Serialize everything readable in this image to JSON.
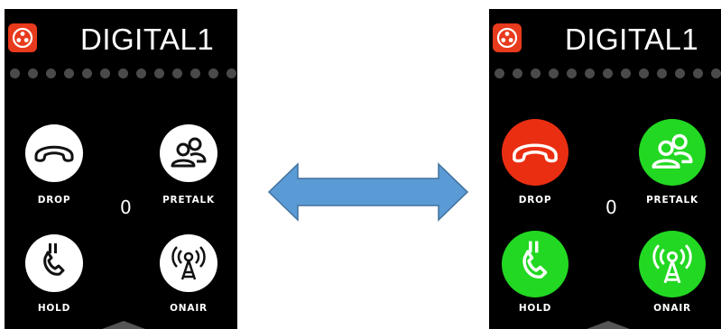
{
  "colors": {
    "screen_bg": "#000000",
    "app_icon_red": "#e83a1c",
    "dot_inactive": "#4a4a4a",
    "button_idle": "#ffffff",
    "button_drop_active": "#ea2e12",
    "button_active_green": "#22d822",
    "arrow_fill": "#5b9bd5",
    "arrow_stroke": "#41719c"
  },
  "left_screen": {
    "title": "DIGITAL1",
    "counter": "0",
    "buttons": {
      "drop": {
        "label": "DROP",
        "icon": "phone-hangup-icon"
      },
      "pretalk": {
        "label": "PRETALK",
        "icon": "people-icon"
      },
      "hold": {
        "label": "HOLD",
        "icon": "phone-hold-icon"
      },
      "onair": {
        "label": "ONAIR",
        "icon": "broadcast-antenna-icon"
      }
    }
  },
  "right_screen": {
    "title": "DIGITAL1",
    "counter": "0",
    "buttons": {
      "drop": {
        "label": "DROP",
        "icon": "phone-hangup-icon"
      },
      "pretalk": {
        "label": "PRETALK",
        "icon": "people-icon"
      },
      "hold": {
        "label": "HOLD",
        "icon": "phone-hold-icon"
      },
      "onair": {
        "label": "ONAIR",
        "icon": "broadcast-antenna-icon"
      }
    }
  },
  "connector": {
    "icon": "double-headed-arrow-icon"
  }
}
